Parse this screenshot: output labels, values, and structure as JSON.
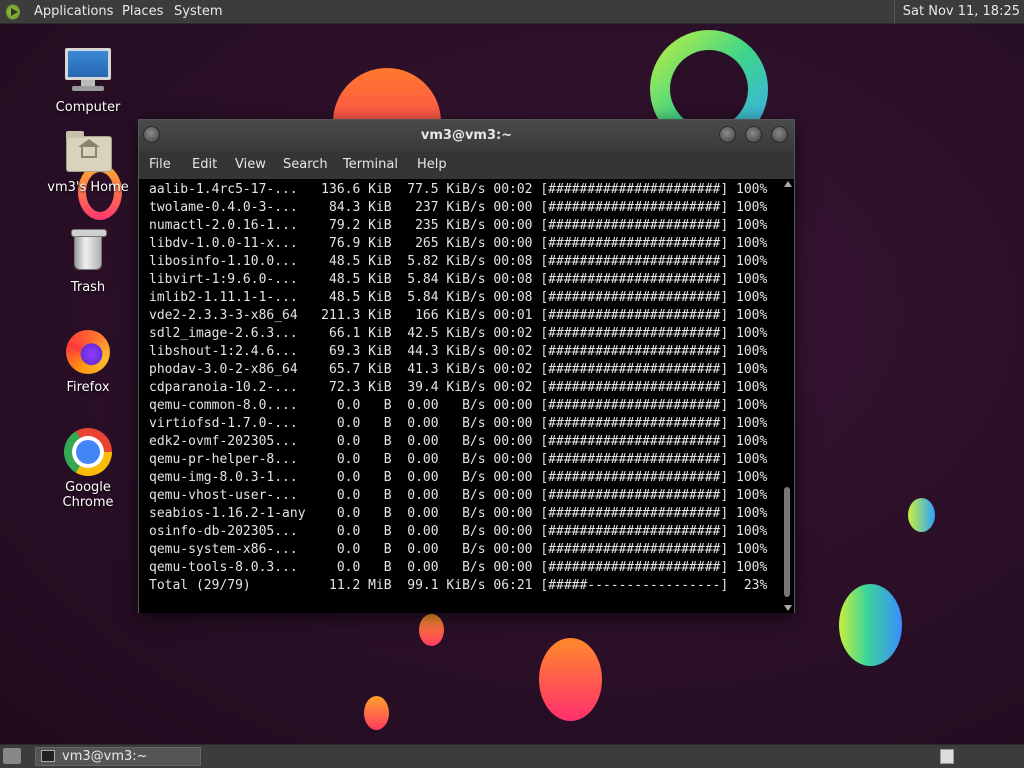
{
  "top_panel": {
    "menus": [
      "Applications",
      "Places",
      "System"
    ],
    "clock": "Sat Nov 11, 18:25"
  },
  "desktop_icons": [
    {
      "label": "Computer",
      "icon": "computer-icon"
    },
    {
      "label": "vm3's Home",
      "icon": "home-folder-icon"
    },
    {
      "label": "Trash",
      "icon": "trash-icon"
    },
    {
      "label": "Firefox",
      "icon": "firefox-icon"
    },
    {
      "label": "Google Chrome",
      "icon": "chrome-icon"
    }
  ],
  "window": {
    "title": "vm3@vm3:~",
    "menu": [
      "File",
      "Edit",
      "View",
      "Search",
      "Terminal",
      "Help"
    ]
  },
  "terminal": {
    "lines": [
      "aalib-1.4rc5-17-...   136.6 KiB  77.5 KiB/s 00:02 [######################] 100%",
      "twolame-0.4.0-3-...    84.3 KiB   237 KiB/s 00:00 [######################] 100%",
      "numactl-2.0.16-1...    79.2 KiB   235 KiB/s 00:00 [######################] 100%",
      "libdv-1.0.0-11-x...    76.9 KiB   265 KiB/s 00:00 [######################] 100%",
      "libosinfo-1.10.0...    48.5 KiB  5.82 KiB/s 00:08 [######################] 100%",
      "libvirt-1:9.6.0-...    48.5 KiB  5.84 KiB/s 00:08 [######################] 100%",
      "imlib2-1.11.1-1-...    48.5 KiB  5.84 KiB/s 00:08 [######################] 100%",
      "vde2-2.3.3-3-x86_64   211.3 KiB   166 KiB/s 00:01 [######################] 100%",
      "sdl2_image-2.6.3...    66.1 KiB  42.5 KiB/s 00:02 [######################] 100%",
      "libshout-1:2.4.6...    69.3 KiB  44.3 KiB/s 00:02 [######################] 100%",
      "phodav-3.0-2-x86_64    65.7 KiB  41.3 KiB/s 00:02 [######################] 100%",
      "cdparanoia-10.2-...    72.3 KiB  39.4 KiB/s 00:02 [######################] 100%",
      "qemu-common-8.0....     0.0   B  0.00   B/s 00:00 [######################] 100%",
      "virtiofsd-1.7.0-...     0.0   B  0.00   B/s 00:00 [######################] 100%",
      "edk2-ovmf-202305...     0.0   B  0.00   B/s 00:00 [######################] 100%",
      "qemu-pr-helper-8...     0.0   B  0.00   B/s 00:00 [######################] 100%",
      "qemu-img-8.0.3-1...     0.0   B  0.00   B/s 00:00 [######################] 100%",
      "qemu-vhost-user-...     0.0   B  0.00   B/s 00:00 [######################] 100%",
      "seabios-1.16.2-1-any    0.0   B  0.00   B/s 00:00 [######################] 100%",
      "osinfo-db-202305...     0.0   B  0.00   B/s 00:00 [######################] 100%",
      "qemu-system-x86-...     0.0   B  0.00   B/s 00:00 [######################] 100%",
      "qemu-tools-8.0.3...     0.0   B  0.00   B/s 00:00 [######################] 100%",
      "Total (29/79)          11.2 MiB  99.1 KiB/s 06:21 [#####-----------------]  23%"
    ]
  },
  "taskbar": {
    "task_label": "vm3@vm3:~"
  }
}
